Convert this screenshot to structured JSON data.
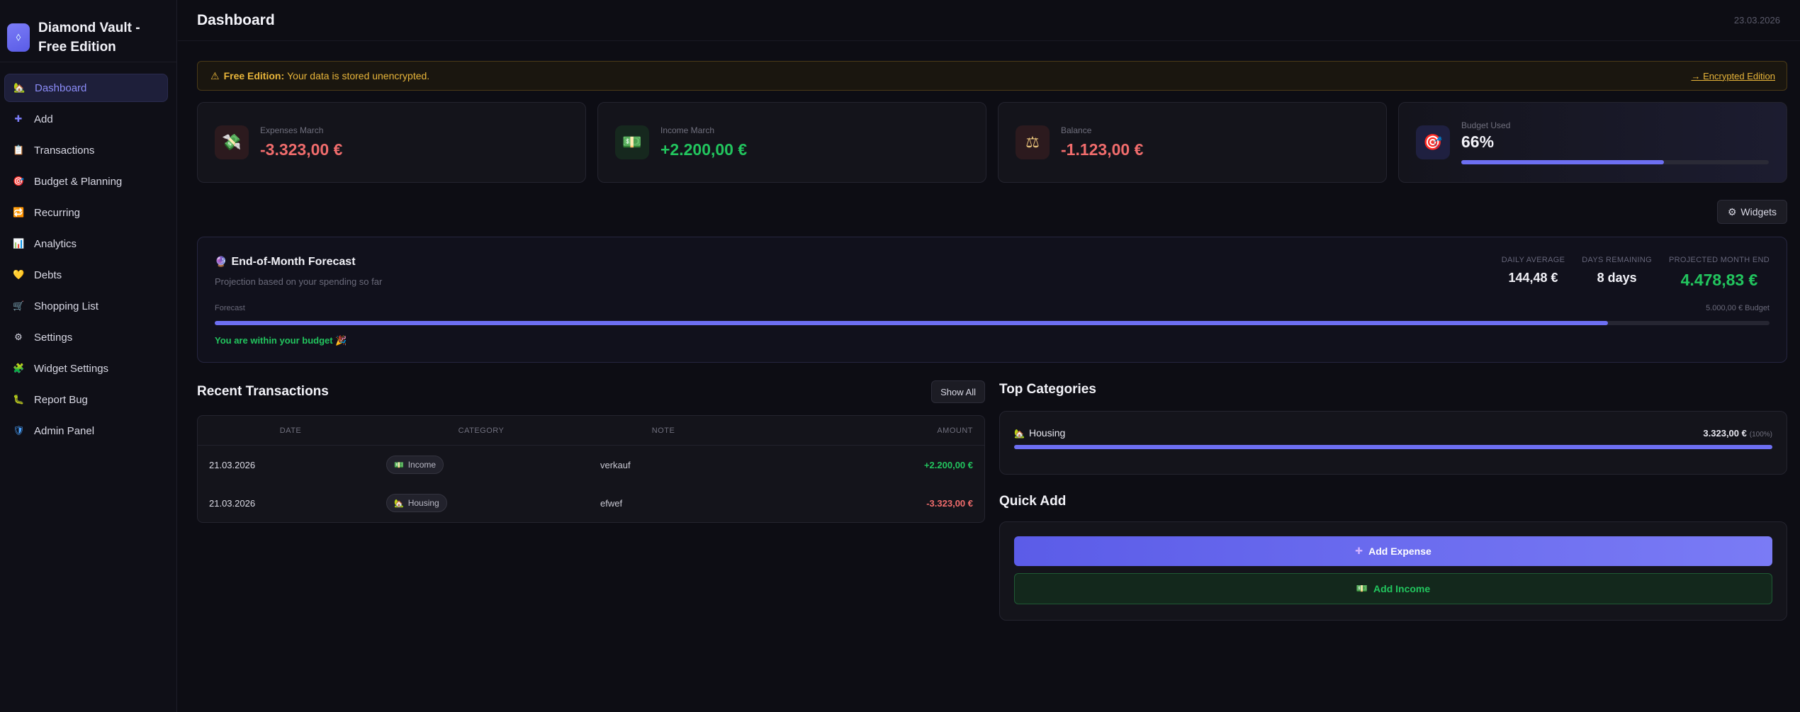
{
  "app": {
    "title": "Diamond Vault - Free Edition"
  },
  "sidebar": {
    "items": [
      {
        "label": "Dashboard",
        "icon": "🏡"
      },
      {
        "label": "Add",
        "icon": "✚"
      },
      {
        "label": "Transactions",
        "icon": "📋"
      },
      {
        "label": "Budget & Planning",
        "icon": "🎯"
      },
      {
        "label": "Recurring",
        "icon": "🔁"
      },
      {
        "label": "Analytics",
        "icon": "📊"
      },
      {
        "label": "Debts",
        "icon": "💛"
      },
      {
        "label": "Shopping List",
        "icon": "🛒"
      },
      {
        "label": "Settings",
        "icon": "⚙"
      },
      {
        "label": "Widget Settings",
        "icon": "🧩"
      },
      {
        "label": "Report Bug",
        "icon": "🐛"
      },
      {
        "label": "Admin Panel",
        "icon": "🛡"
      }
    ]
  },
  "header": {
    "title": "Dashboard",
    "date": "23.03.2026"
  },
  "alert": {
    "label": "Free Edition:",
    "text": "Your data is stored unencrypted.",
    "link": "→ Encrypted Edition"
  },
  "stats": {
    "expenses": {
      "label": "Expenses March",
      "value": "-3.323,00 €",
      "icon": "💸"
    },
    "income": {
      "label": "Income March",
      "value": "+2.200,00 €",
      "icon": "💵"
    },
    "balance": {
      "label": "Balance",
      "value": "-1.123,00 €",
      "icon": "⚖"
    },
    "budget": {
      "label": "Budget Used",
      "value": "66%",
      "fraction": 0.66,
      "icon": "🎯"
    }
  },
  "widgets_button": "Widgets",
  "forecast": {
    "title": "End-of-Month Forecast",
    "subtitle": "Projection based on your spending so far",
    "daily_average_label": "DAILY AVERAGE",
    "daily_average": "144,48 €",
    "days_remaining_label": "DAYS REMAINING",
    "days_remaining": "8 days",
    "projected_label": "PROJECTED MONTH END",
    "projected": "4.478,83 €",
    "bar_label": "Forecast",
    "budget_label": "5.000,00 € Budget",
    "fraction": 0.896,
    "status": "You are within your budget 🎉"
  },
  "transactions": {
    "title": "Recent Transactions",
    "show_all": "Show All",
    "headers": [
      "DATE",
      "CATEGORY",
      "NOTE",
      "AMOUNT"
    ],
    "rows": [
      {
        "date": "21.03.2026",
        "category": "Income",
        "category_icon": "💵",
        "note": "verkauf",
        "amount": "+2.200,00 €"
      },
      {
        "date": "21.03.2026",
        "category": "Housing",
        "category_icon": "🏡",
        "note": "efwef",
        "amount": "-3.323,00 €"
      }
    ]
  },
  "top_categories": {
    "title": "Top Categories",
    "items": [
      {
        "name": "Housing",
        "icon": "🏡",
        "amount": "3.323,00 €",
        "percent": "(100%)",
        "fraction": 1.0
      }
    ]
  },
  "quick_add": {
    "title": "Quick Add",
    "expense_label": "Add Expense",
    "income_label": "Add Income"
  }
}
